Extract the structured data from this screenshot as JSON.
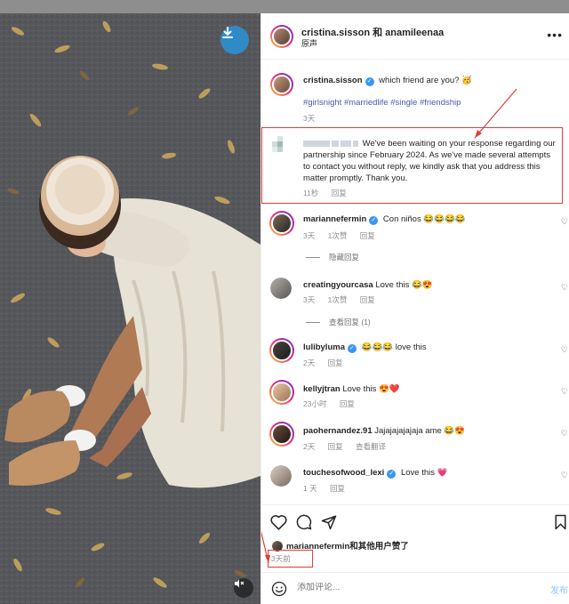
{
  "post": {
    "header": {
      "usernames": "cristina.sisson 和 anamileenaa",
      "audio_label": "原声",
      "more_label": "•••"
    },
    "caption": {
      "username": "cristina.sisson",
      "text": "which friend are you? 🥳",
      "hashtags": "#girlsnight #marriedlife #single #friendship",
      "time": "3天"
    },
    "highlighted_comment": {
      "text": "We've been waiting on your response regarding our partnership since February 2024. As we've made several attempts to contact you without reply, we kindly ask that you address this matter promptly. Thank you.",
      "time": "11秒",
      "reply": "回复"
    },
    "comments": [
      {
        "username": "mariannefermin",
        "text": "Con niños 😂😂😂😂",
        "time": "3天",
        "likes": "1次赞",
        "reply": "回复",
        "verified": true,
        "thread": "隐藏回复"
      },
      {
        "username": "creatingyourcasa",
        "text": "Love this 😂😍",
        "time": "3天",
        "likes": "1次赞",
        "reply": "回复",
        "verified": false,
        "thread": "查看回复 (1)"
      },
      {
        "username": "lulibyluma",
        "text": "😂😂😂 love this",
        "time": "2天",
        "reply": "回复",
        "verified": true
      },
      {
        "username": "kellyjtran",
        "text": "Love this 😍❤️",
        "time": "23小时",
        "reply": "回复",
        "verified": false
      },
      {
        "username": "paohernandez.91",
        "text": "Jajajajajajaja ame 😂😍",
        "time": "2天",
        "reply": "回复",
        "translate": "查看翻译",
        "verified": false
      },
      {
        "username": "touchesofwood_lexi",
        "text": "Love this 💗",
        "time": "1 天",
        "reply": "回复",
        "verified": true
      }
    ],
    "likes_text": "mariannefermin和其他用户赞了",
    "date": "3天前",
    "add_comment": {
      "placeholder": "添加评论...",
      "post_label": "发布"
    }
  },
  "icons": {
    "download": "download-icon",
    "mute": "muted-speaker-icon",
    "heart": "heart-icon",
    "comment": "comment-icon",
    "share": "share-icon",
    "bookmark": "bookmark-icon",
    "emoji": "emoji-icon"
  },
  "colors": {
    "accent": "#3897f0",
    "hashtag": "#4a5aa8",
    "highlight_border": "#e03c3c",
    "post_button": "#8fc4ff"
  }
}
